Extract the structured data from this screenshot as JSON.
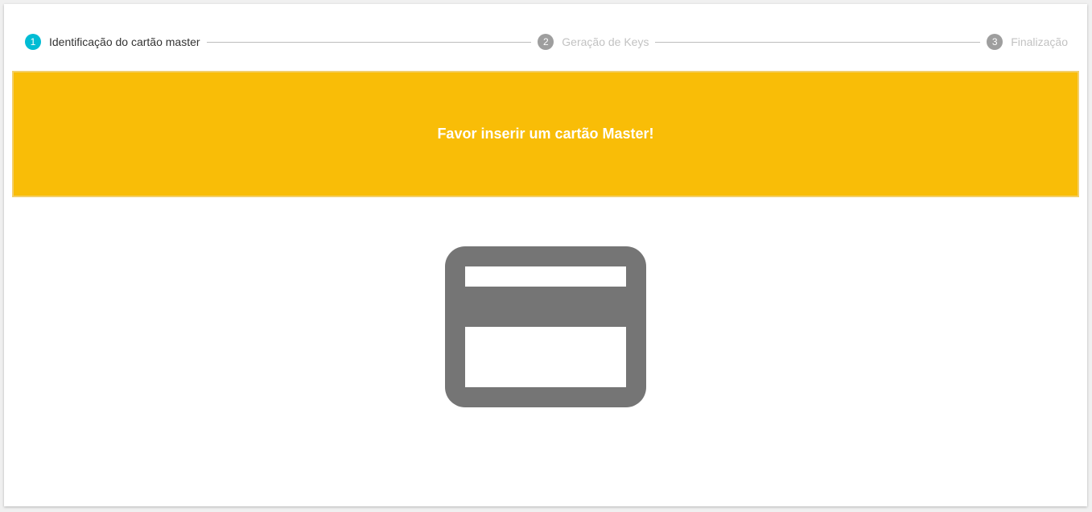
{
  "stepper": {
    "steps": [
      {
        "number": "1",
        "label": "Identificação do cartão master",
        "state": "active"
      },
      {
        "number": "2",
        "label": "Geração de Keys",
        "state": "inactive"
      },
      {
        "number": "3",
        "label": "Finalização",
        "state": "inactive"
      }
    ]
  },
  "alert": {
    "message": "Favor inserir um cartão Master!",
    "color": "#f9bd07"
  },
  "icon": {
    "name": "credit-card-icon",
    "color": "#757575"
  },
  "colors": {
    "active_step": "#00bcd4",
    "inactive_step": "#9e9e9e"
  }
}
